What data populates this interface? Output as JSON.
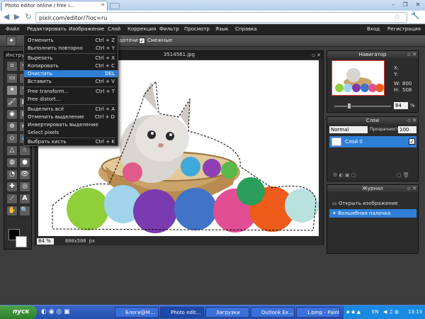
{
  "browser": {
    "tab_title": "Photo editor online / free i...",
    "url": "pixlr.com/editor/?loc=ru"
  },
  "menu": [
    "Файл",
    "Редактировать",
    "Изображение",
    "Слой",
    "Коррекция",
    "Фильтр",
    "Просмотр",
    "Язык",
    "Справка"
  ],
  "account": {
    "login": "Вход",
    "register": "Регистрация"
  },
  "options": {
    "contiguous_partial": "едоточить",
    "antialias": "Смежные"
  },
  "tools_title": "Инстру",
  "document": {
    "title": "3514561.jpg",
    "zoom": "84",
    "zoom_unit": "%",
    "size": "800x508 px"
  },
  "edit_menu": [
    {
      "label": "Отменить",
      "shortcut": "Ctrl + Z"
    },
    {
      "label": "Выполнить повторно",
      "shortcut": "Ctrl + Y"
    },
    {
      "label": "Вырезать",
      "shortcut": "Ctrl + X"
    },
    {
      "label": "Копировать",
      "shortcut": "Ctrl + C"
    },
    {
      "label": "Очистить",
      "shortcut": "DEL"
    },
    {
      "label": "Вставить",
      "shortcut": "Ctrl + V"
    },
    {
      "label": "Free transform...",
      "shortcut": "Ctrl + T"
    },
    {
      "label": "Free distort...",
      "shortcut": ""
    },
    {
      "label": "Выделить всё",
      "shortcut": "Ctrl + A"
    },
    {
      "label": "Отменить выделение",
      "shortcut": "Ctrl + D"
    },
    {
      "label": "Инвертировать выделение",
      "shortcut": ""
    },
    {
      "label": "Select pixels",
      "shortcut": ""
    },
    {
      "label": "Выбрать кисть",
      "shortcut": "Ctrl + K"
    }
  ],
  "navigator": {
    "title": "Навигатор",
    "x_label": "X:",
    "y_label": "Y:",
    "w_label": "W:",
    "w_value": "800",
    "h_label": "H:",
    "h_value": "508",
    "zoom": "84",
    "zoom_unit": "%"
  },
  "layers": {
    "title": "Слои",
    "blend": "Normal",
    "opacity_label": "Прозрачность",
    "opacity": "100",
    "layer_name": "Слой 0"
  },
  "history": {
    "title": "Журнал",
    "items": [
      "Открыть изображение",
      "Волшебная палочка"
    ]
  },
  "taskbar": {
    "start": "пуск",
    "tasks": [
      "Блоги@M...",
      "Photo edit...",
      "Загрузки",
      "Outlook Ex...",
      "1.bmp - Paint"
    ],
    "lang": "EN",
    "time": "13:13"
  },
  "colors": {
    "accent": "#2f7fd7",
    "menubar": "#232323",
    "taskbar": "#2450b0"
  }
}
